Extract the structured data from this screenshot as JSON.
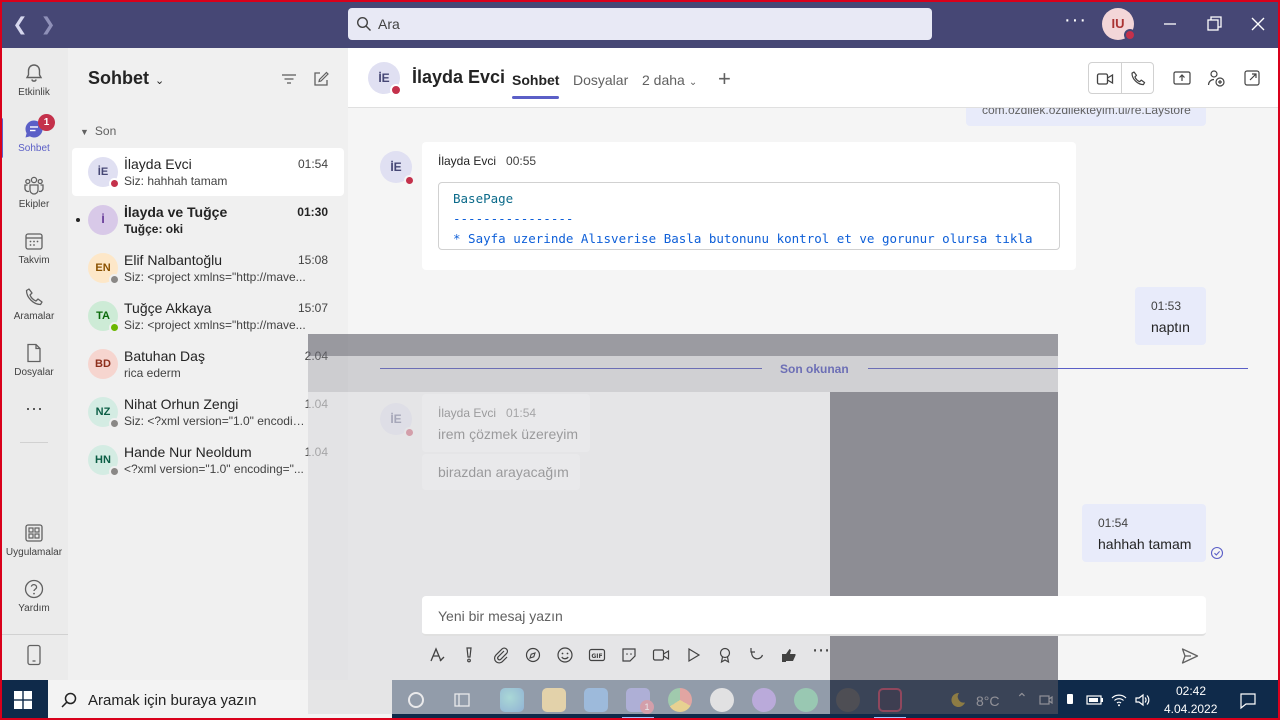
{
  "search": {
    "placeholder": "Ara"
  },
  "topbar": {
    "more": "···",
    "avatar_initials": "IU"
  },
  "rail": {
    "items": [
      {
        "label": "Etkinlik"
      },
      {
        "label": "Sohbet",
        "badge": "1"
      },
      {
        "label": "Ekipler"
      },
      {
        "label": "Takvim"
      },
      {
        "label": "Aramalar"
      },
      {
        "label": "Dosyalar"
      },
      {
        "label": "···"
      },
      {
        "label": "Uygulamalar"
      },
      {
        "label": "Yardım"
      }
    ]
  },
  "chatlist": {
    "title": "Sohbet",
    "section": "Son",
    "chats": [
      {
        "initials": "İE",
        "name": "İlayda Evci",
        "time": "01:54",
        "preview": "Siz: hahhah tamam",
        "status_color": "#c4314b",
        "avatar_bg": "#e0e0f2",
        "avatar_fg": "#464775"
      },
      {
        "initials": "İ",
        "name": "İlayda ve Tuğçe",
        "time": "01:30",
        "preview": "Tuğçe: oki",
        "status_color": "",
        "avatar_bg": "#d8c9e8",
        "avatar_fg": "#5c2e91"
      },
      {
        "initials": "EN",
        "name": "Elif Nalbantoğlu",
        "time": "15:08",
        "preview": "Siz: <project xmlns=\"http://mave...",
        "status_color": "#8a8886",
        "avatar_bg": "#fde7c8",
        "avatar_fg": "#8a5100"
      },
      {
        "initials": "TA",
        "name": "Tuğçe Akkaya",
        "time": "15:07",
        "preview": "Siz: <project xmlns=\"http://mave...",
        "status_color": "#6bb700",
        "avatar_bg": "#cdebd6",
        "avatar_fg": "#0b6a0b"
      },
      {
        "initials": "BD",
        "name": "Batuhan Daş",
        "time": "2.04",
        "preview": "rica ederm",
        "status_color": "",
        "avatar_bg": "#f6d5cf",
        "avatar_fg": "#8e2f1c"
      },
      {
        "initials": "NZ",
        "name": "Nihat Orhun Zengi",
        "time": "1.04",
        "preview": "Siz: <?xml version=\"1.0\" encoding...",
        "status_color": "#8a8886",
        "avatar_bg": "#d4ece3",
        "avatar_fg": "#0b5e45"
      },
      {
        "initials": "HN",
        "name": "Hande Nur Neoldum",
        "time": "1.04",
        "preview": "<?xml version=\"1.0\" encoding=\"...",
        "status_color": "#8a8886",
        "avatar_bg": "#d4ece3",
        "avatar_fg": "#0b5e45"
      }
    ]
  },
  "conversation": {
    "name": "İlayda Evci",
    "initials": "İE",
    "tabs": [
      "Sohbet",
      "Dosyalar",
      "2 daha"
    ],
    "partial_top": "com.ozdilek.ozdilekteyim.ui/re.Laystore",
    "messages": {
      "m1": {
        "sender": "İlayda Evci",
        "time": "00:55",
        "code_line1": "BasePage",
        "code_line2": "----------------",
        "code_line3": "* Sayfa uzerinde Alısverise Basla butonunu kontrol et ve gorunur olursa tıkla"
      },
      "m2": {
        "time": "01:53",
        "text": "naptın"
      },
      "divider": "Son okunan",
      "m3": {
        "sender": "İlayda Evci",
        "time": "01:54",
        "text": "irem çözmek üzereyim"
      },
      "m4": {
        "text": "birazdan arayacağım"
      },
      "m5": {
        "time": "01:54",
        "text": "hahhah tamam"
      }
    },
    "compose_placeholder": "Yeni bir mesaj yazın"
  },
  "taskbar": {
    "search_placeholder": "Aramak için buraya yazın",
    "teams_badge": "1",
    "temperature": "8°C",
    "time": "02:42",
    "date": "4.04.2022"
  },
  "colors": {
    "titlebar": "#464775",
    "accent": "#5b5fc7",
    "busy": "#c4314b",
    "taskbar": "#0f2a4a"
  }
}
